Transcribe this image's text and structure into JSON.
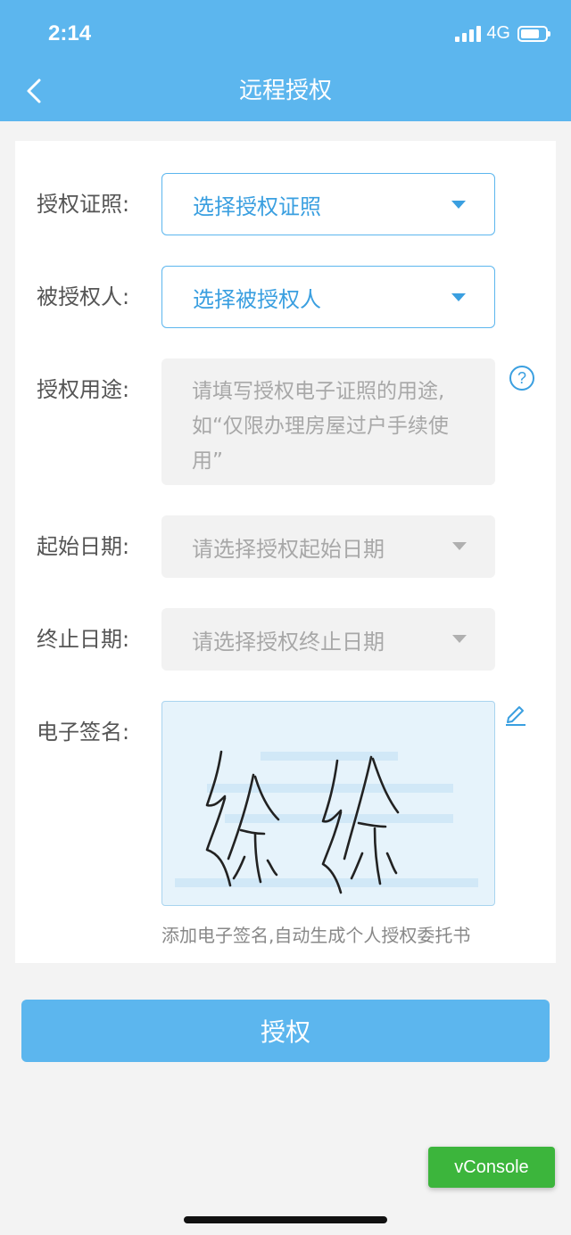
{
  "status_bar": {
    "time": "2:14",
    "network": "4G",
    "battery_percent": 75
  },
  "header": {
    "title": "远程授权"
  },
  "form": {
    "license": {
      "label": "授权证照:",
      "value": "选择授权证照"
    },
    "grantee": {
      "label": "被授权人:",
      "value": "选择被授权人"
    },
    "purpose": {
      "label": "授权用途:",
      "placeholder": "请填写授权电子证照的用途,如“仅限办理房屋过户手续使用”"
    },
    "start_date": {
      "label": "起始日期:",
      "placeholder": "请选择授权起始日期"
    },
    "end_date": {
      "label": "终止日期:",
      "placeholder": "请选择授权终止日期"
    },
    "signature": {
      "label": "电子签名:",
      "hint": "添加电子签名,自动生成个人授权委托书"
    }
  },
  "submit_button": "授权",
  "vconsole": "vConsole",
  "colors": {
    "primary": "#5cb6ee",
    "accent_text": "#3a9fe0",
    "vconsole": "#3cb53c"
  }
}
